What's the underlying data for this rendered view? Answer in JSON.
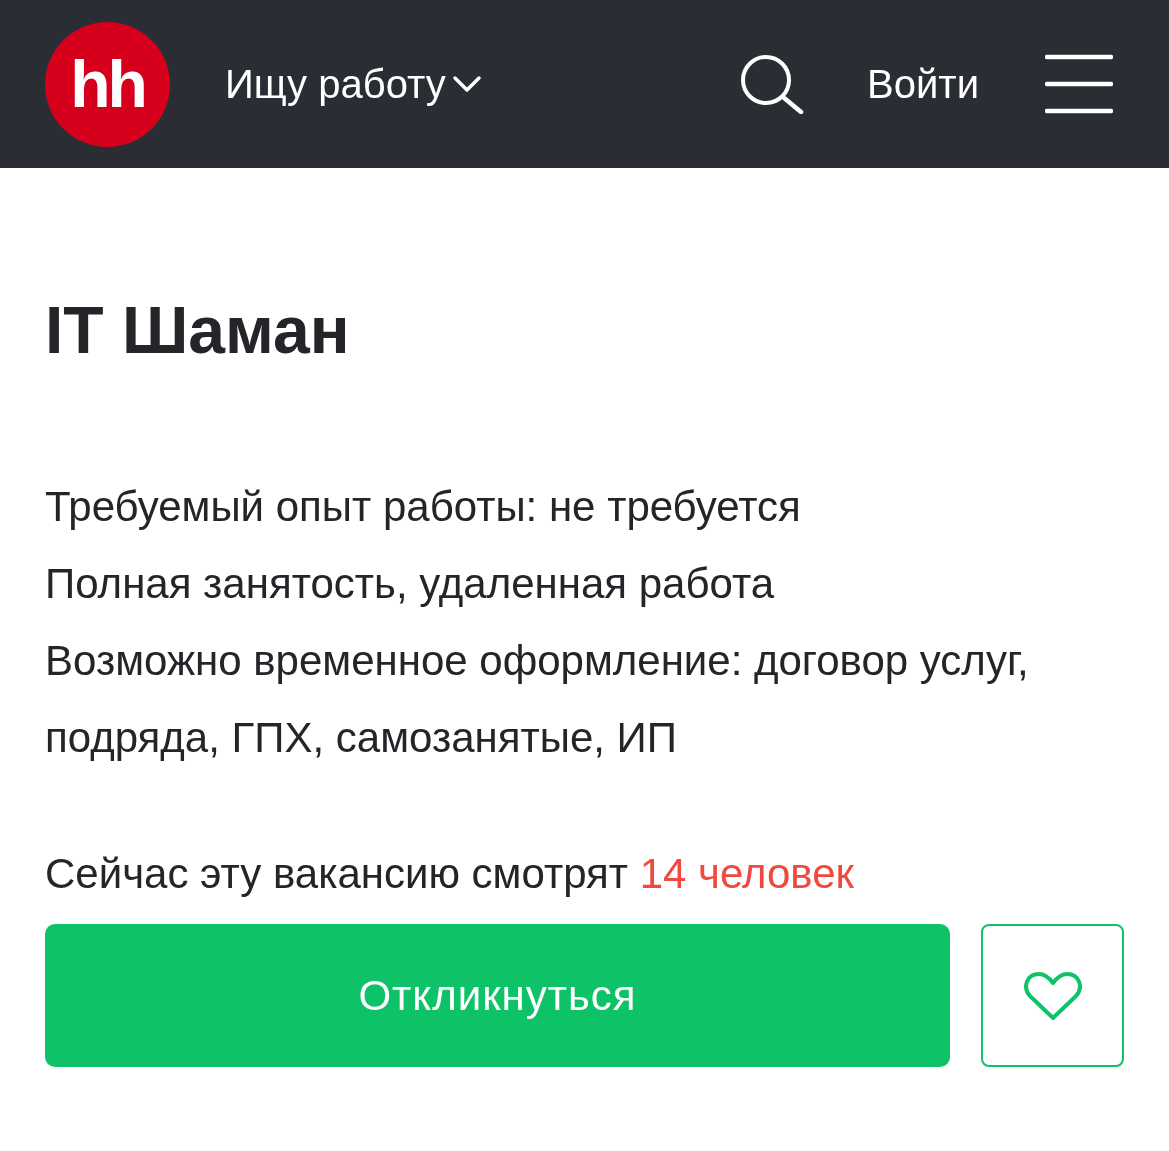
{
  "header": {
    "logo": "hh",
    "mode_menu": "Ищу работу",
    "login": "Войти"
  },
  "vacancy": {
    "title": "IT Шаман",
    "details": [
      "Требуемый опыт работы: не требуется",
      "Полная занятость, удаленная работа",
      "Возможно временное оформление: договор услуг, подряда, ГПХ, самозанятые, ИП"
    ],
    "viewers_text": "Сейчас эту вакансию смотрят",
    "viewers_count": "14 человек",
    "apply_button": "Откликнуться",
    "favorite": {
      "selected": false
    }
  }
}
